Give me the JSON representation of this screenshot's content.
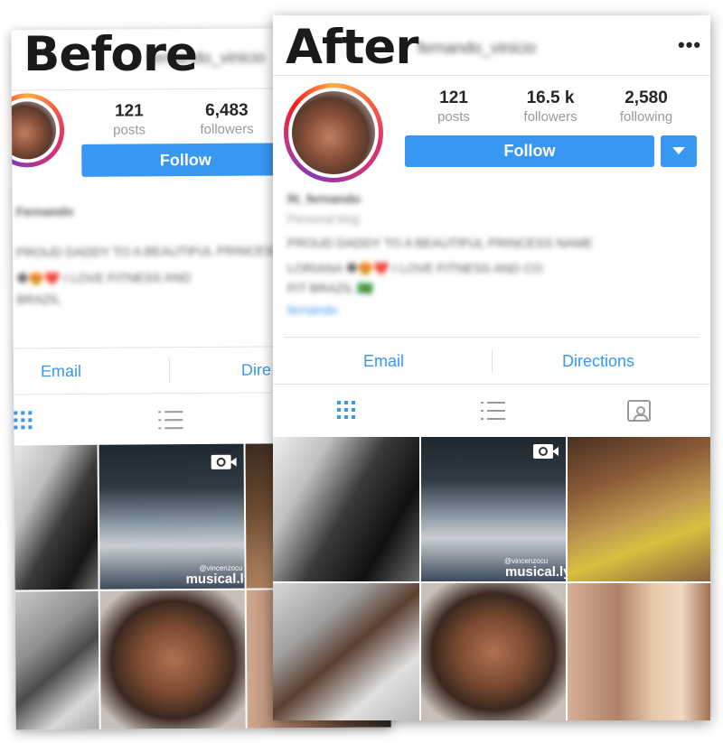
{
  "before": {
    "heading": "Before",
    "username": "fernando_vinicio",
    "stats": [
      {
        "value": "121",
        "label": "posts"
      },
      {
        "value": "6,483",
        "label": "followers"
      }
    ],
    "follow_label": "Follow",
    "bio": {
      "name": "Fernando",
      "lines": [
        "PROUD DADDY TO A BEAUTIFUL PRINCESS",
        "🏶😍❤️ I LOVE FITNESS AND",
        "BRAZIL"
      ]
    },
    "actions": {
      "email": "Email",
      "directions": "Dire"
    }
  },
  "after": {
    "heading": "After",
    "username": "fernando_vinicio",
    "stats": [
      {
        "value": "121",
        "label": "posts"
      },
      {
        "value": "16.5 k",
        "label": "followers"
      },
      {
        "value": "2,580",
        "label": "following"
      }
    ],
    "follow_label": "Follow",
    "bio": {
      "name": "fit_fernando",
      "category": "Personal blog",
      "lines": [
        "PROUD DADDY TO A BEAUTIFUL PRINCESS NAME",
        "LORIANA 🏶😍❤️ I LOVE FITNESS AND CO",
        "FIT BRAZIL 🇧🇷"
      ],
      "link": "fernando"
    },
    "actions": {
      "email": "Email",
      "directions": "Directions"
    },
    "more_label": "•••"
  },
  "video_overlay": {
    "handle": "@vincenzocu",
    "brand": "musical.ly"
  },
  "icons": [
    "grid-view-icon",
    "list-view-icon",
    "tagged-icon",
    "video-icon",
    "dropdown-chevron-icon",
    "more-options-icon"
  ],
  "colors": {
    "accent": "#3897f0",
    "text": "#262626",
    "muted": "#999999",
    "divider": "#e3e3e3"
  }
}
